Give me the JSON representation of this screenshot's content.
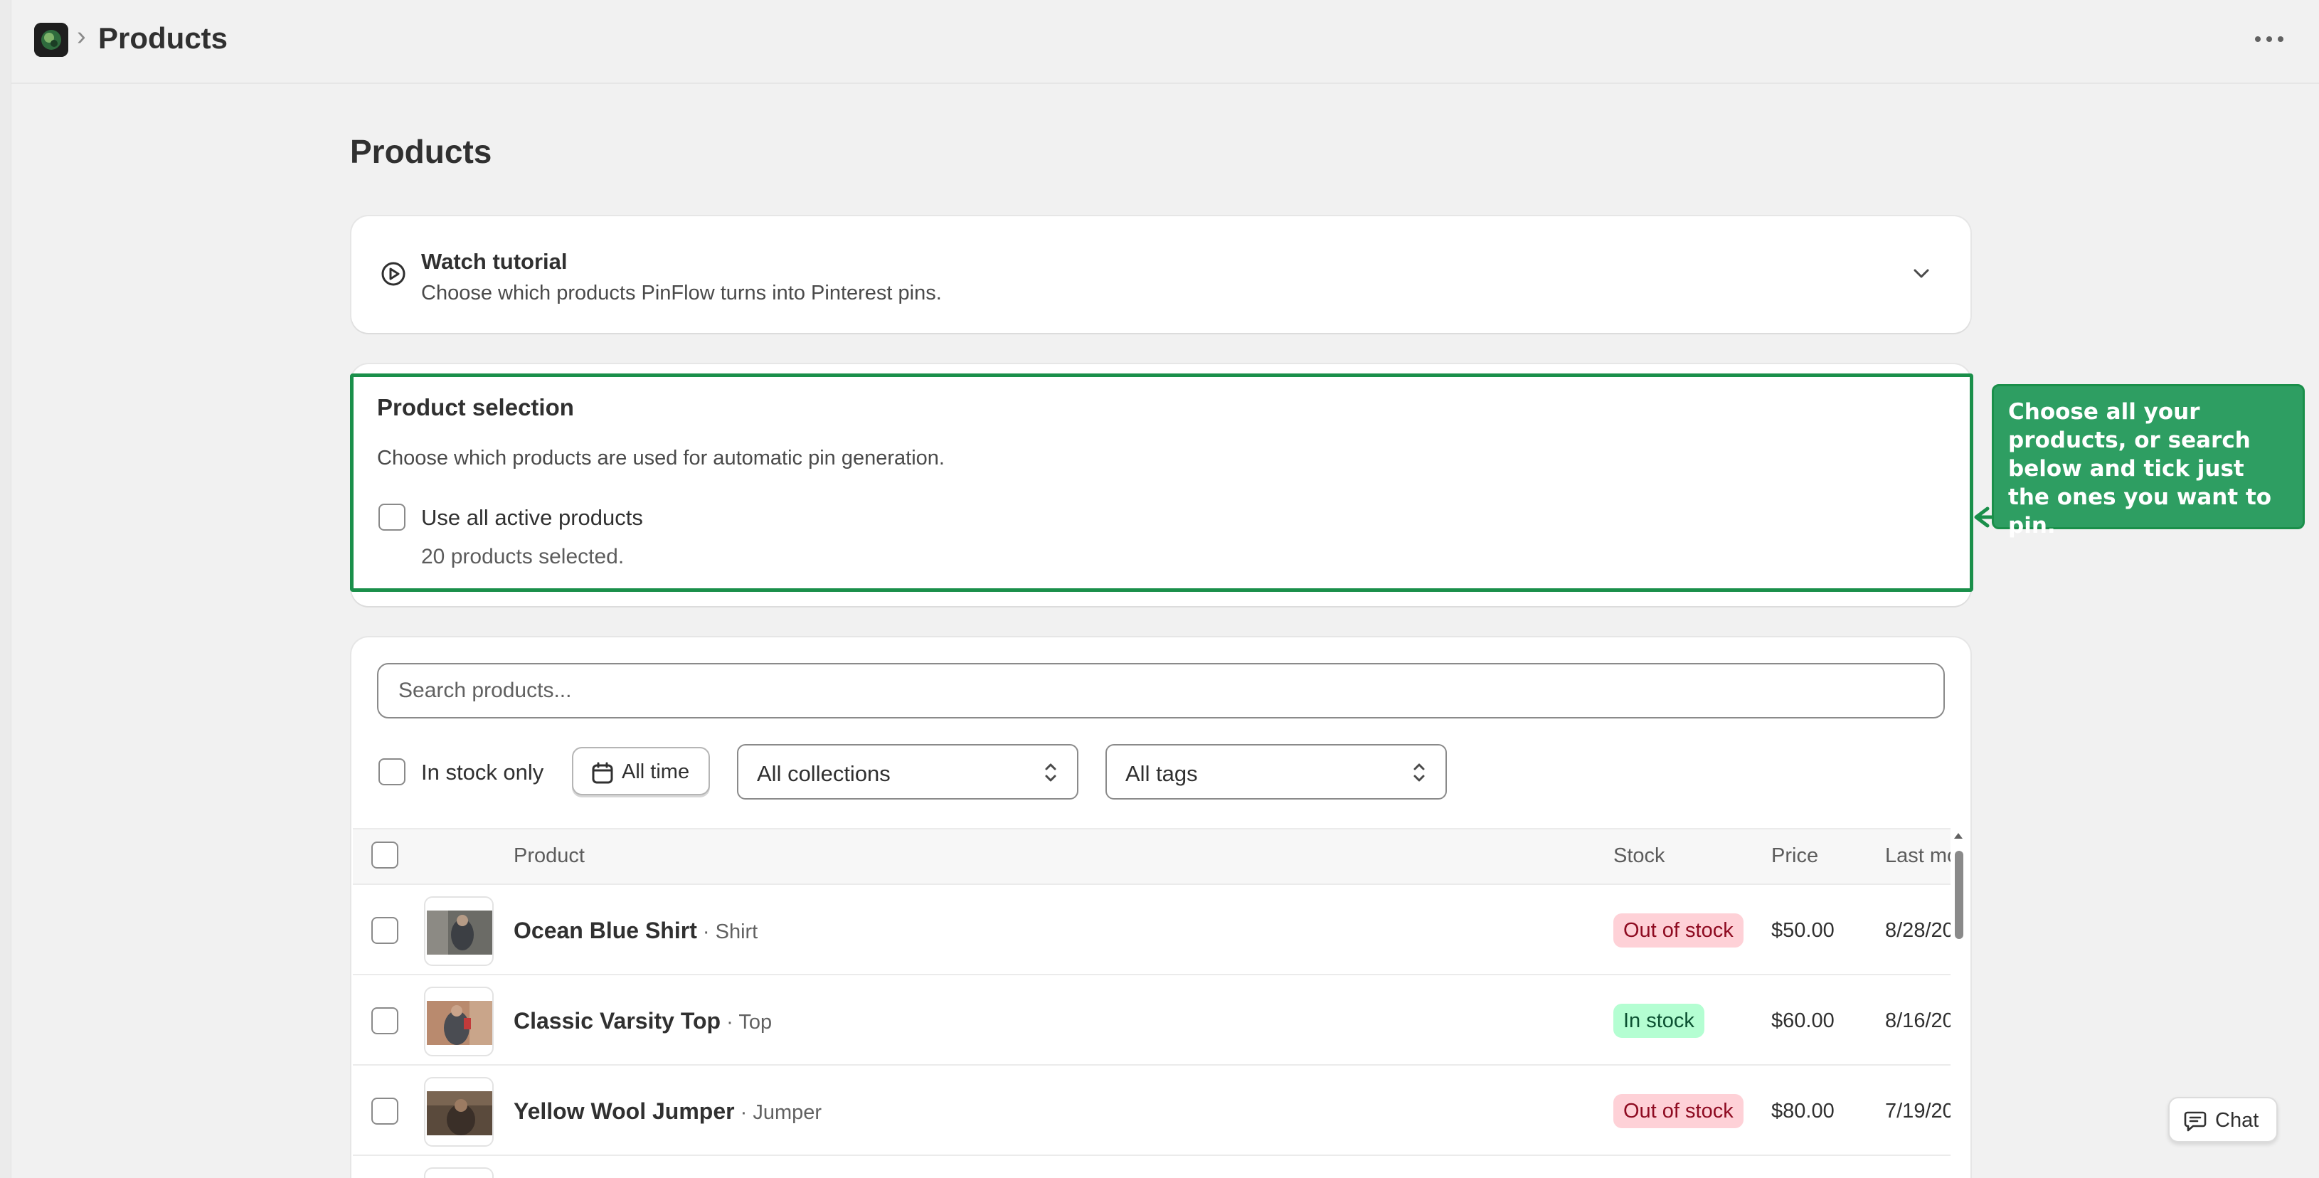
{
  "header": {
    "breadcrumb_separator": "›",
    "title": "Products",
    "more_icon": "more-horizontal-icon"
  },
  "page": {
    "title": "Products"
  },
  "tutorial": {
    "title": "Watch tutorial",
    "description": "Choose which products PinFlow turns into Pinterest pins.",
    "icon": "play-circle-icon"
  },
  "selection": {
    "title": "Product selection",
    "description": "Choose which products are used for automatic pin generation.",
    "checkbox_label": "Use all active products",
    "checked": false,
    "count_text": "20 products selected."
  },
  "callout": {
    "text": "Choose all your products, or search below and tick just the ones you want to pin.",
    "color": "#2e9e62"
  },
  "filters": {
    "search_placeholder": "Search products...",
    "in_stock_label": "In stock only",
    "date_button": "All time",
    "collections_select": "All collections",
    "tags_select": "All tags"
  },
  "table": {
    "columns": {
      "product": "Product",
      "stock": "Stock",
      "price": "Price",
      "last_modified": "Last mo"
    },
    "rows": [
      {
        "name": "Ocean Blue Shirt",
        "type": " · Shirt",
        "stock": "Out of stock",
        "stock_status": "out",
        "price": "$50.00",
        "last_modified": "8/28/20"
      },
      {
        "name": "Classic Varsity Top",
        "type": " · Top",
        "stock": "In stock",
        "stock_status": "in",
        "price": "$60.00",
        "last_modified": "8/16/20"
      },
      {
        "name": "Yellow Wool Jumper",
        "type": " · Jumper",
        "stock": "Out of stock",
        "stock_status": "out",
        "price": "$80.00",
        "last_modified": "7/19/20"
      }
    ]
  },
  "chat": {
    "label": "Chat"
  },
  "colors": {
    "accent_green": "#1a8f4a",
    "out_of_stock_bg": "#fed1d7",
    "in_stock_bg": "#b4fed2"
  }
}
